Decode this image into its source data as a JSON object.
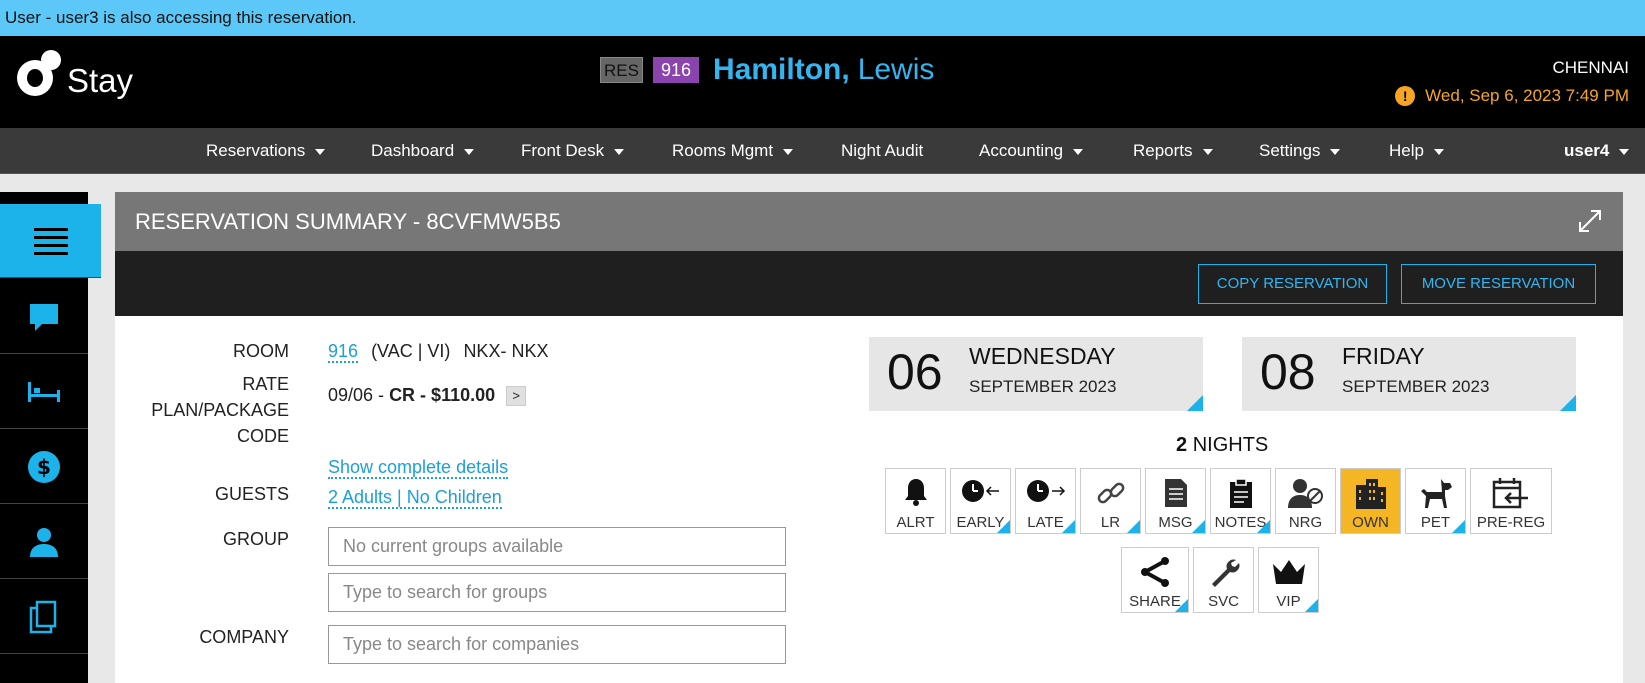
{
  "notice": {
    "text": "User - user3 is also accessing this reservation."
  },
  "header": {
    "logo_text": "Stay",
    "res_badge": "RES",
    "room_badge": "916",
    "guest_last": "Hamilton,",
    "guest_first": "Lewis",
    "location": "CHENNAI",
    "datetime": "Wed, Sep 6, 2023 7:49 PM",
    "warn_symbol": "!"
  },
  "nav": {
    "items": [
      {
        "label": "Reservations"
      },
      {
        "label": "Dashboard"
      },
      {
        "label": "Front Desk"
      },
      {
        "label": "Rooms Mgmt"
      },
      {
        "label": "Night Audit"
      },
      {
        "label": "Accounting"
      },
      {
        "label": "Reports"
      },
      {
        "label": "Settings"
      },
      {
        "label": "Help"
      }
    ],
    "user": "user4"
  },
  "sidebar": {
    "icons": [
      "menu-icon",
      "chat-icon",
      "bed-icon",
      "dollar-icon",
      "person-icon",
      "documents-icon"
    ]
  },
  "panel": {
    "title": "RESERVATION SUMMARY - 8CVFMW5B5",
    "copy_button": "COPY RESERVATION",
    "move_button": "MOVE RESERVATION"
  },
  "details": {
    "room_label": "ROOM",
    "room_number": "916",
    "room_status": "(VAC | VI)",
    "room_type": "NKX- NKX",
    "rate_label_1": "RATE",
    "rate_label_2": "PLAN/PACKAGE",
    "rate_label_3": "CODE",
    "rate_date": "09/06 -",
    "rate_value": "CR - $110.00",
    "rate_chevron": ">",
    "show_details": "Show complete details",
    "guests_label": "GUESTS",
    "guests_value": "2 Adults | No Children",
    "group_label": "GROUP",
    "group_value": "No current groups available",
    "group_search_placeholder": "Type to search for groups",
    "company_label": "COMPANY",
    "company_search_placeholder": "Type to search for companies"
  },
  "arrival": {
    "day_num": "06",
    "weekday": "WEDNESDAY",
    "month_year": "SEPTEMBER 2023"
  },
  "departure": {
    "day_num": "08",
    "weekday": "FRIDAY",
    "month_year": "SEPTEMBER 2023"
  },
  "nights": {
    "count": "2",
    "label": "NIGHTS"
  },
  "flags": [
    {
      "label": "ALRT",
      "icon": "bell-icon",
      "active": false
    },
    {
      "label": "EARLY",
      "icon": "clock-left-icon",
      "active": false
    },
    {
      "label": "LATE",
      "icon": "clock-right-icon",
      "active": false
    },
    {
      "label": "LR",
      "icon": "link-icon",
      "active": false
    },
    {
      "label": "MSG",
      "icon": "message-doc-icon",
      "active": false
    },
    {
      "label": "NOTES",
      "icon": "clipboard-icon",
      "active": false
    },
    {
      "label": "NRG",
      "icon": "person-block-icon",
      "active": false
    },
    {
      "label": "OWN",
      "icon": "building-icon",
      "active": true
    },
    {
      "label": "PET",
      "icon": "dog-icon",
      "active": false
    },
    {
      "label": "PRE-REG",
      "icon": "calendar-arrow-icon",
      "active": false
    },
    {
      "label": "SHARE",
      "icon": "share-icon",
      "active": false
    },
    {
      "label": "SVC",
      "icon": "wrench-icon",
      "active": false
    },
    {
      "label": "VIP",
      "icon": "crown-icon",
      "active": false
    }
  ],
  "colors": {
    "accent": "#1bb3ea",
    "notice": "#5bc8f8",
    "warning": "#f5a623",
    "own_flag": "#f5b626",
    "room_badge": "#8b44ad"
  }
}
